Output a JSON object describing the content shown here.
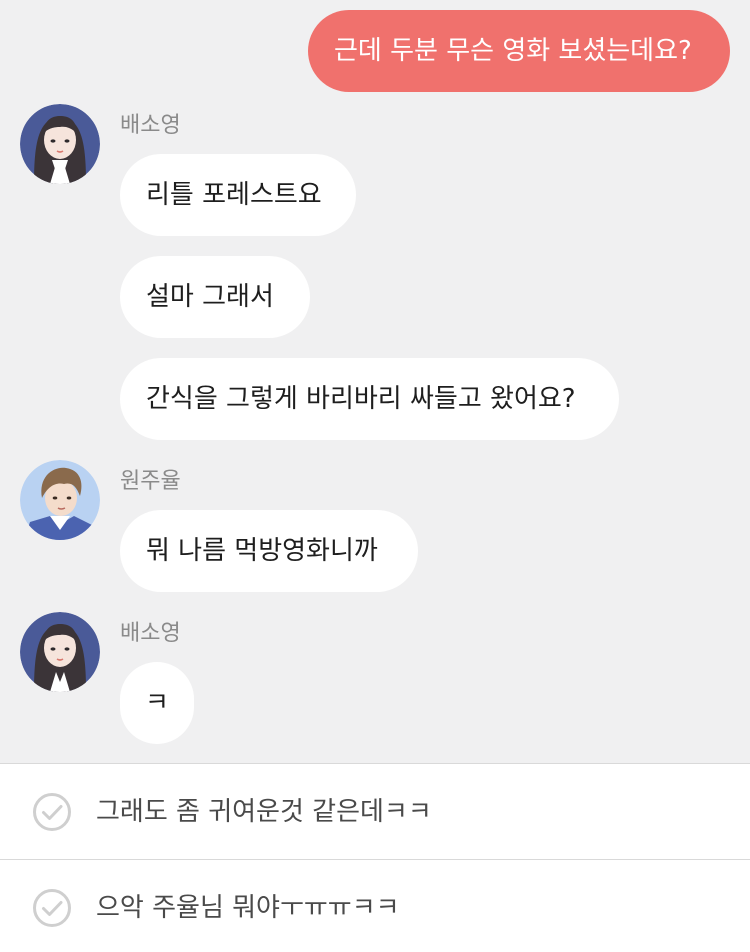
{
  "messages": [
    {
      "side": "out",
      "text": "근데 두분 무슨 영화 보셨는데요?"
    },
    {
      "side": "in",
      "sender": "배소영",
      "avatar": "female-avatar",
      "texts": [
        "리틀 포레스트요",
        "설마 그래서",
        "간식을 그렇게 바리바리 싸들고 왔어요?"
      ]
    },
    {
      "side": "in",
      "sender": "원주율",
      "avatar": "male-avatar",
      "texts": [
        "뭐 나름 먹방영화니까"
      ]
    },
    {
      "side": "in",
      "sender": "배소영",
      "avatar": "female-avatar",
      "texts": [
        "ㅋ"
      ]
    }
  ],
  "choices": [
    {
      "label": "그래도 좀 귀여운것 같은데ㅋㅋ",
      "icon": "check-circle-icon"
    },
    {
      "label": "으악 주율님 뭐야ㅜㅠㅠㅋㅋ",
      "icon": "check-circle-icon"
    }
  ],
  "colors": {
    "outgoing_bubble": "#f0716d",
    "incoming_bubble": "#ffffff",
    "background": "#f0f0f1"
  }
}
